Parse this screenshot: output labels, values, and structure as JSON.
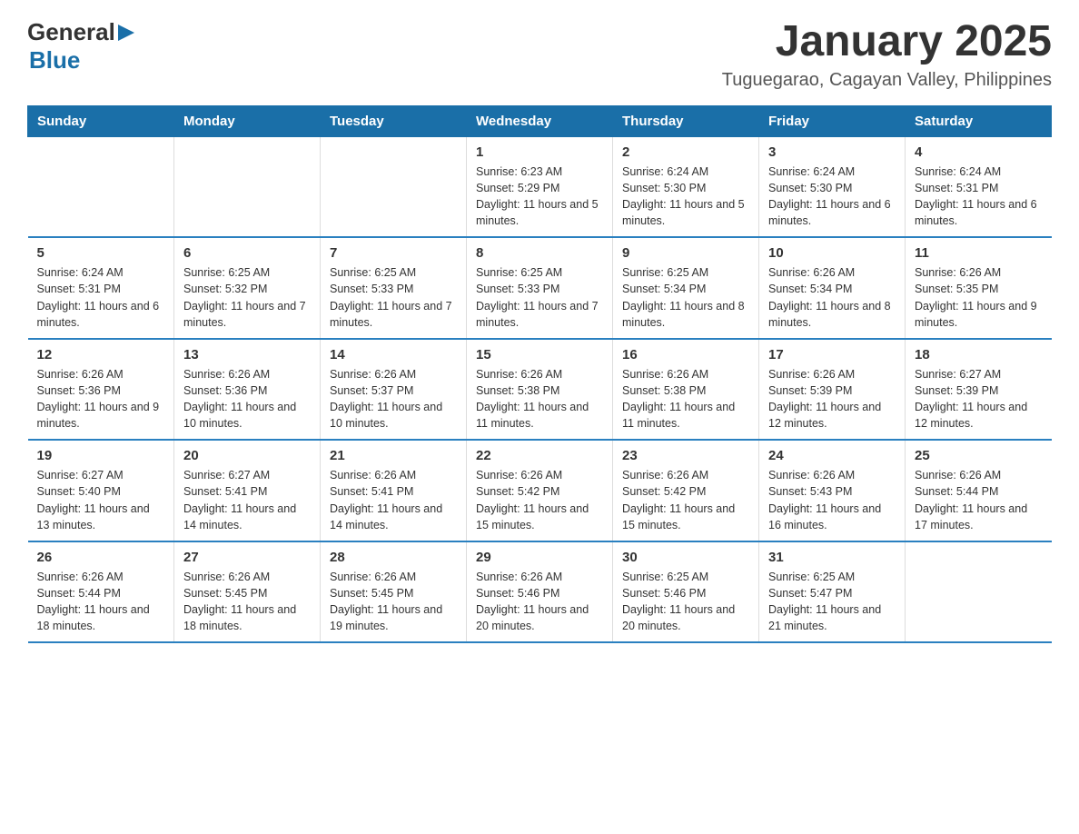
{
  "logo": {
    "general": "General",
    "blue": "Blue"
  },
  "title": "January 2025",
  "subtitle": "Tuguegarao, Cagayan Valley, Philippines",
  "days_header": [
    "Sunday",
    "Monday",
    "Tuesday",
    "Wednesday",
    "Thursday",
    "Friday",
    "Saturday"
  ],
  "weeks": [
    [
      {
        "day": "",
        "info": ""
      },
      {
        "day": "",
        "info": ""
      },
      {
        "day": "",
        "info": ""
      },
      {
        "day": "1",
        "info": "Sunrise: 6:23 AM\nSunset: 5:29 PM\nDaylight: 11 hours and 5 minutes."
      },
      {
        "day": "2",
        "info": "Sunrise: 6:24 AM\nSunset: 5:30 PM\nDaylight: 11 hours and 5 minutes."
      },
      {
        "day": "3",
        "info": "Sunrise: 6:24 AM\nSunset: 5:30 PM\nDaylight: 11 hours and 6 minutes."
      },
      {
        "day": "4",
        "info": "Sunrise: 6:24 AM\nSunset: 5:31 PM\nDaylight: 11 hours and 6 minutes."
      }
    ],
    [
      {
        "day": "5",
        "info": "Sunrise: 6:24 AM\nSunset: 5:31 PM\nDaylight: 11 hours and 6 minutes."
      },
      {
        "day": "6",
        "info": "Sunrise: 6:25 AM\nSunset: 5:32 PM\nDaylight: 11 hours and 7 minutes."
      },
      {
        "day": "7",
        "info": "Sunrise: 6:25 AM\nSunset: 5:33 PM\nDaylight: 11 hours and 7 minutes."
      },
      {
        "day": "8",
        "info": "Sunrise: 6:25 AM\nSunset: 5:33 PM\nDaylight: 11 hours and 7 minutes."
      },
      {
        "day": "9",
        "info": "Sunrise: 6:25 AM\nSunset: 5:34 PM\nDaylight: 11 hours and 8 minutes."
      },
      {
        "day": "10",
        "info": "Sunrise: 6:26 AM\nSunset: 5:34 PM\nDaylight: 11 hours and 8 minutes."
      },
      {
        "day": "11",
        "info": "Sunrise: 6:26 AM\nSunset: 5:35 PM\nDaylight: 11 hours and 9 minutes."
      }
    ],
    [
      {
        "day": "12",
        "info": "Sunrise: 6:26 AM\nSunset: 5:36 PM\nDaylight: 11 hours and 9 minutes."
      },
      {
        "day": "13",
        "info": "Sunrise: 6:26 AM\nSunset: 5:36 PM\nDaylight: 11 hours and 10 minutes."
      },
      {
        "day": "14",
        "info": "Sunrise: 6:26 AM\nSunset: 5:37 PM\nDaylight: 11 hours and 10 minutes."
      },
      {
        "day": "15",
        "info": "Sunrise: 6:26 AM\nSunset: 5:38 PM\nDaylight: 11 hours and 11 minutes."
      },
      {
        "day": "16",
        "info": "Sunrise: 6:26 AM\nSunset: 5:38 PM\nDaylight: 11 hours and 11 minutes."
      },
      {
        "day": "17",
        "info": "Sunrise: 6:26 AM\nSunset: 5:39 PM\nDaylight: 11 hours and 12 minutes."
      },
      {
        "day": "18",
        "info": "Sunrise: 6:27 AM\nSunset: 5:39 PM\nDaylight: 11 hours and 12 minutes."
      }
    ],
    [
      {
        "day": "19",
        "info": "Sunrise: 6:27 AM\nSunset: 5:40 PM\nDaylight: 11 hours and 13 minutes."
      },
      {
        "day": "20",
        "info": "Sunrise: 6:27 AM\nSunset: 5:41 PM\nDaylight: 11 hours and 14 minutes."
      },
      {
        "day": "21",
        "info": "Sunrise: 6:26 AM\nSunset: 5:41 PM\nDaylight: 11 hours and 14 minutes."
      },
      {
        "day": "22",
        "info": "Sunrise: 6:26 AM\nSunset: 5:42 PM\nDaylight: 11 hours and 15 minutes."
      },
      {
        "day": "23",
        "info": "Sunrise: 6:26 AM\nSunset: 5:42 PM\nDaylight: 11 hours and 15 minutes."
      },
      {
        "day": "24",
        "info": "Sunrise: 6:26 AM\nSunset: 5:43 PM\nDaylight: 11 hours and 16 minutes."
      },
      {
        "day": "25",
        "info": "Sunrise: 6:26 AM\nSunset: 5:44 PM\nDaylight: 11 hours and 17 minutes."
      }
    ],
    [
      {
        "day": "26",
        "info": "Sunrise: 6:26 AM\nSunset: 5:44 PM\nDaylight: 11 hours and 18 minutes."
      },
      {
        "day": "27",
        "info": "Sunrise: 6:26 AM\nSunset: 5:45 PM\nDaylight: 11 hours and 18 minutes."
      },
      {
        "day": "28",
        "info": "Sunrise: 6:26 AM\nSunset: 5:45 PM\nDaylight: 11 hours and 19 minutes."
      },
      {
        "day": "29",
        "info": "Sunrise: 6:26 AM\nSunset: 5:46 PM\nDaylight: 11 hours and 20 minutes."
      },
      {
        "day": "30",
        "info": "Sunrise: 6:25 AM\nSunset: 5:46 PM\nDaylight: 11 hours and 20 minutes."
      },
      {
        "day": "31",
        "info": "Sunrise: 6:25 AM\nSunset: 5:47 PM\nDaylight: 11 hours and 21 minutes."
      },
      {
        "day": "",
        "info": ""
      }
    ]
  ]
}
